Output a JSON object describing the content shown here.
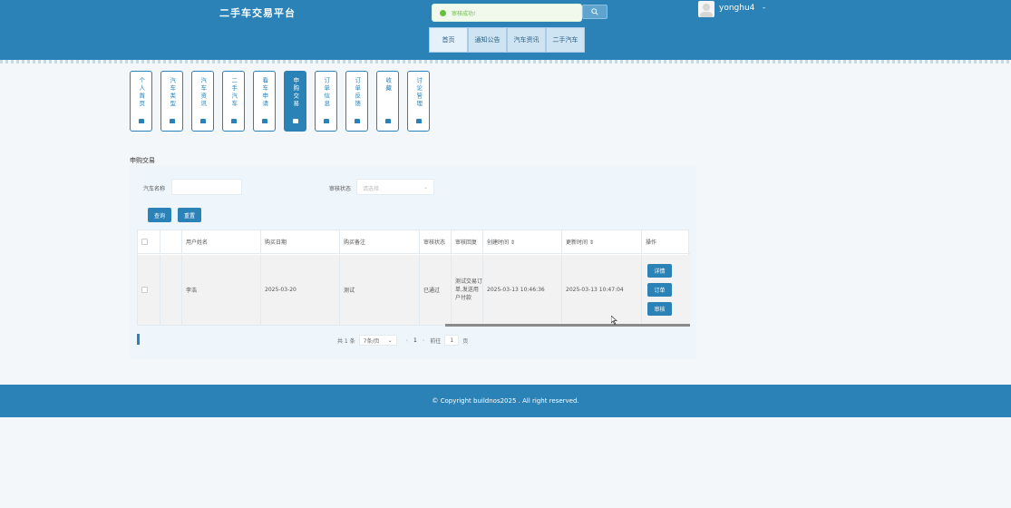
{
  "header": {
    "site_title": "二手车交易平台",
    "toast": "审核成功!",
    "username": "yonghu4",
    "username_suffix": "-"
  },
  "nav": [
    "首页",
    "通知公告",
    "汽车资讯",
    "二手汽车"
  ],
  "menu_tiles": [
    {
      "label": "个人首页",
      "active": false
    },
    {
      "label": "汽车类型",
      "active": false
    },
    {
      "label": "汽车资讯",
      "active": false
    },
    {
      "label": "二手汽车",
      "active": false
    },
    {
      "label": "看车申请",
      "active": false
    },
    {
      "label": "申购交易",
      "active": true
    },
    {
      "label": "订单信息",
      "active": false
    },
    {
      "label": "订单反馈",
      "active": false
    },
    {
      "label": "收藏",
      "active": false
    },
    {
      "label": "讨论管理",
      "active": false
    }
  ],
  "section_title": "申购交易",
  "filters": {
    "car_name_label": "汽车名称",
    "car_name_value": "",
    "review_status_label": "审核状态",
    "review_status_placeholder": "请选择"
  },
  "buttons": {
    "query": "查询",
    "reset": "重置"
  },
  "table": {
    "headers": [
      "",
      "",
      "用户姓名",
      "购买日期",
      "购买备注",
      "审核状态",
      "审核回复",
      "创建时间 ⇕",
      "更新时间 ⇕",
      "操作"
    ],
    "rows": [
      {
        "user_name": "李浩",
        "purchase_date": "2025-03-20",
        "purchase_note": "测试",
        "review_status": "已通过",
        "review_reply": "测试交易订单,发送用户付款",
        "created": "2025-03-13 10:46:36",
        "updated": "2025-03-13 10:47:04"
      }
    ],
    "row_actions": [
      "详情",
      "订单",
      "审核"
    ]
  },
  "pagination": {
    "total": "共 1 条",
    "page_size": "7条/页",
    "current_page": "1",
    "goto_label": "前往",
    "goto_value": "1",
    "page_suffix": "页"
  },
  "footer": "© Copyright buildnos2025 . All right reserved."
}
